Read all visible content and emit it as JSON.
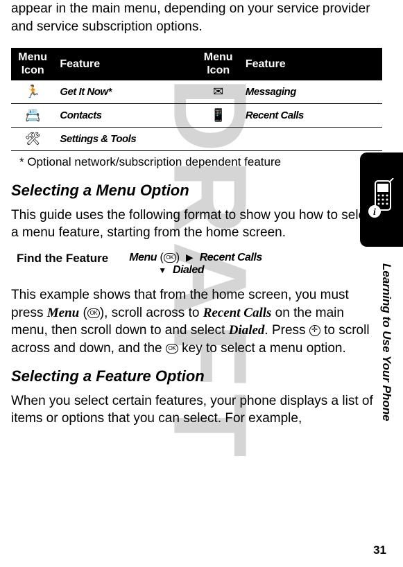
{
  "intro": "appear in the main menu, depending on your service provider and service subscription options.",
  "table": {
    "header": {
      "menuIcon": "Menu Icon",
      "feature": "Feature"
    },
    "rows": [
      {
        "icon1": "🏃",
        "feature1": "Get It Now*",
        "icon2": "✉",
        "feature2": "Messaging"
      },
      {
        "icon1": "📇",
        "feature1": "Contacts",
        "icon2": "📱",
        "feature2": "Recent Calls"
      },
      {
        "icon1": "🛠",
        "feature1": "Settings & Tools",
        "icon2": "",
        "feature2": ""
      }
    ]
  },
  "footnote": "*   Optional network/subscription dependent feature",
  "section1": {
    "heading": "Selecting a Menu Option",
    "para1": "This guide uses the following format to show you how to select a menu feature, starting from the home screen.",
    "findLabel": "Find the Feature",
    "pathMenu": "Menu",
    "pathOk": "OK",
    "pathRecent": "Recent Calls",
    "pathDialed": "Dialed",
    "para2a": "This example shows that from the home screen, you must press ",
    "para2menu": "Menu",
    "para2b": ", scroll across to ",
    "para2recent": "Recent Calls",
    "para2c": " on the main menu, then scroll down to and select ",
    "para2dialed": "Dialed",
    "para2d": ". Press ",
    "para2e": " to scroll across and down, and the ",
    "para2f": " key to select a menu option."
  },
  "section2": {
    "heading": "Selecting a Feature Option",
    "para": "When you select certain features, your phone displays a list of items or options that you can select. For example,"
  },
  "sideLabel": "Learning to Use Your Phone",
  "pageNumber": "31",
  "watermark": {
    "l1": "DR",
    "l2": "AF",
    "l3": "T"
  }
}
